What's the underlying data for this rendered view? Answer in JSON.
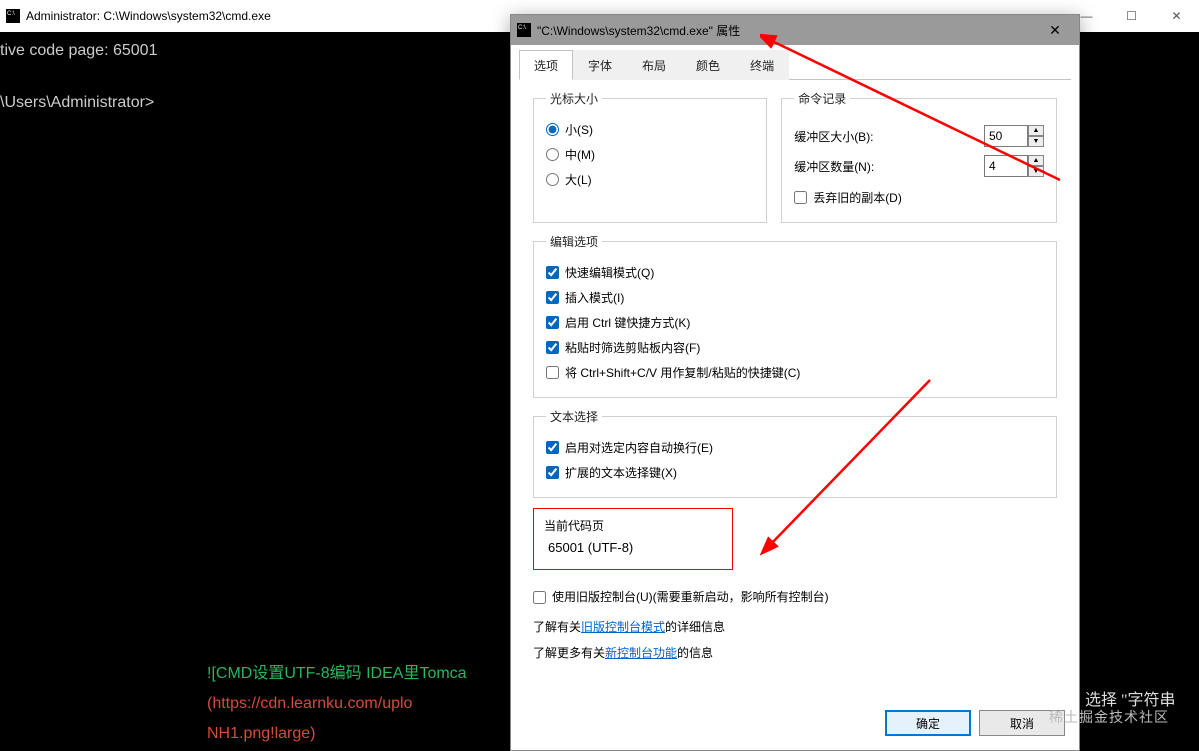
{
  "cmd": {
    "title": "Administrator: C:\\Windows\\system32\\cmd.exe",
    "line1": "tive code page: 65001",
    "line2": "\\Users\\Administrator>"
  },
  "snippet": {
    "green": "![CMD设置UTF-8编码 IDEA里Tomca",
    "red1": "(https://cdn.learnku.com/uplo",
    "red2": "NH1.png!large)",
    "right": "选择  \"字符串"
  },
  "dlg": {
    "title": "\"C:\\Windows\\system32\\cmd.exe\" 属性",
    "close": "✕",
    "tabs": [
      "选项",
      "字体",
      "布局",
      "颜色",
      "终端"
    ],
    "cursor": {
      "legend": "光标大小",
      "small": "小(S)",
      "medium": "中(M)",
      "large": "大(L)"
    },
    "history": {
      "legend": "命令记录",
      "buf_label": "缓冲区大小(B):",
      "buf_val": "50",
      "num_label": "缓冲区数量(N):",
      "num_val": "4",
      "discard": "丢弃旧的副本(D)"
    },
    "edit": {
      "legend": "编辑选项",
      "quick": "快速编辑模式(Q)",
      "insert": "插入模式(I)",
      "ctrl": "启用 Ctrl 键快捷方式(K)",
      "filter": "粘贴时筛选剪贴板内容(F)",
      "ctrlshift": "将 Ctrl+Shift+C/V 用作复制/粘贴的快捷键(C)"
    },
    "textsel": {
      "legend": "文本选择",
      "wrap": "启用对选定内容自动换行(E)",
      "ext": "扩展的文本选择键(X)"
    },
    "codepage": {
      "legend": "当前代码页",
      "value": "65001 (UTF-8)"
    },
    "legacy_chk": "使用旧版控制台(U)(需要重新启动，影响所有控制台)",
    "info1_a": "了解有关",
    "info1_link": "旧版控制台模式",
    "info1_b": "的详细信息",
    "info2_a": "了解更多有关",
    "info2_link": "新控制台功能",
    "info2_b": "的信息",
    "ok": "确定",
    "cancel": "取消"
  },
  "watermark": "稀土掘金技术社区"
}
